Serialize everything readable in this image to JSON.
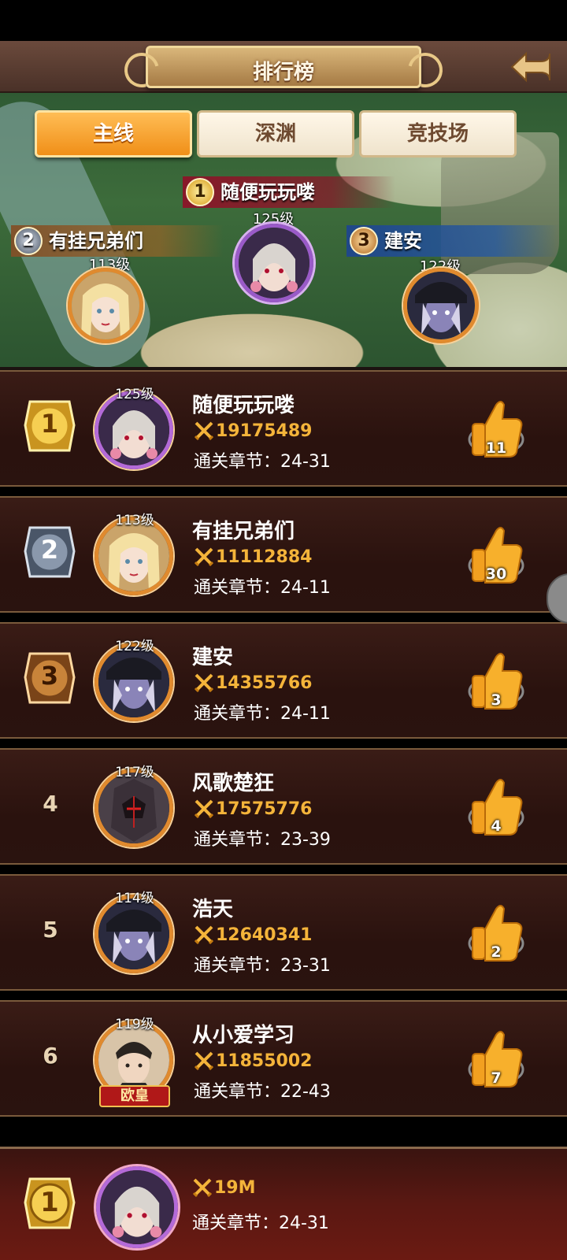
{
  "header": {
    "title": "排行榜"
  },
  "tabs": [
    {
      "label": "主线",
      "active": true
    },
    {
      "label": "深渊",
      "active": false
    },
    {
      "label": "竞技场",
      "active": false
    }
  ],
  "podium": [
    {
      "rank": "1",
      "name": "随便玩玩喽",
      "level": "125级"
    },
    {
      "rank": "2",
      "name": "有挂兄弟们",
      "level": "113级"
    },
    {
      "rank": "3",
      "name": "建安",
      "level": "122级"
    }
  ],
  "rows": [
    {
      "rank": "1",
      "level": "125级",
      "name": "随便玩玩喽",
      "power": "19175489",
      "chapter": "通关章节：24-31",
      "likes": "11",
      "medal": "gold",
      "avatar": "pale"
    },
    {
      "rank": "2",
      "level": "113级",
      "name": "有挂兄弟们",
      "power": "11112884",
      "chapter": "通关章节：24-11",
      "likes": "30",
      "medal": "silver",
      "avatar": "blonde"
    },
    {
      "rank": "3",
      "level": "122级",
      "name": "建安",
      "power": "14355766",
      "chapter": "通关章节：24-11",
      "likes": "3",
      "medal": "bronze",
      "avatar": "dark"
    },
    {
      "rank": "4",
      "level": "117级",
      "name": "风歌楚狂",
      "power": "17575776",
      "chapter": "通关章节：23-39",
      "likes": "4",
      "medal": "",
      "avatar": "armor"
    },
    {
      "rank": "5",
      "level": "114级",
      "name": "浩天",
      "power": "12640341",
      "chapter": "通关章节：23-31",
      "likes": "2",
      "medal": "",
      "avatar": "dark"
    },
    {
      "rank": "6",
      "level": "119级",
      "name": "从小爱学习",
      "power": "11855002",
      "chapter": "通关章节：22-43",
      "likes": "7",
      "medal": "",
      "avatar": "man",
      "badge": "欧皇"
    }
  ],
  "my_rank": {
    "rank": "1",
    "power": "19M",
    "chapter": "通关章节：24-31"
  },
  "colors": {
    "power": "#f4b43a",
    "tab_active": "#f5a02a",
    "row_bg": "#2a120e"
  }
}
